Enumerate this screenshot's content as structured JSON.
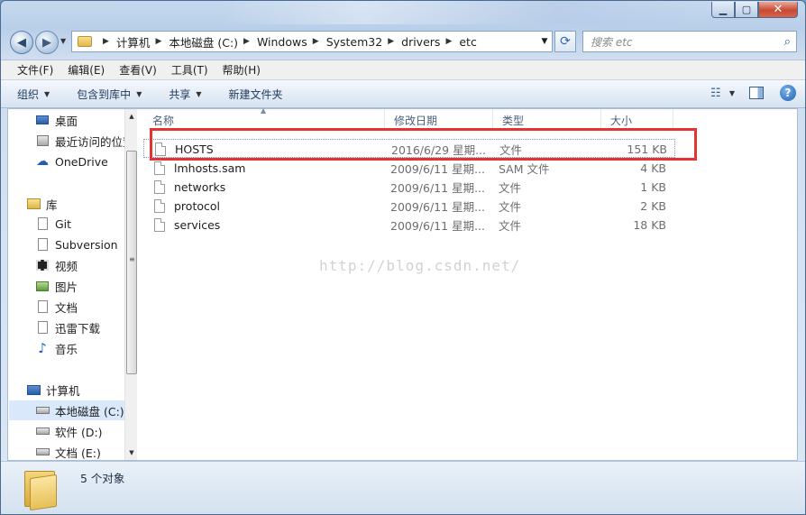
{
  "address": {
    "crumbs": [
      "计算机",
      "本地磁盘 (C:)",
      "Windows",
      "System32",
      "drivers",
      "etc"
    ]
  },
  "search": {
    "placeholder": "搜索 etc"
  },
  "menu": [
    "文件(F)",
    "编辑(E)",
    "查看(V)",
    "工具(T)",
    "帮助(H)"
  ],
  "toolbar": {
    "organize": "组织",
    "include_in_library": "包含到库中",
    "share": "共享",
    "new_folder": "新建文件夹"
  },
  "nav": {
    "desktop": "桌面",
    "recent": "最近访问的位置",
    "onedrive": "OneDrive",
    "libraries": "库",
    "git": "Git",
    "subversion": "Subversion",
    "videos": "视频",
    "pictures": "图片",
    "documents": "文档",
    "xunlei": "迅雷下载",
    "music": "音乐",
    "computer": "计算机",
    "local_c": "本地磁盘 (C:)",
    "soft_d": "软件 (D:)",
    "docs_e": "文档 (E:)"
  },
  "columns": {
    "name": "名称",
    "date": "修改日期",
    "type": "类型",
    "size": "大小"
  },
  "files": [
    {
      "name": "HOSTS",
      "date": "2016/6/29 星期...",
      "type": "文件",
      "size": "151 KB"
    },
    {
      "name": "lmhosts.sam",
      "date": "2009/6/11 星期...",
      "type": "SAM 文件",
      "size": "4 KB"
    },
    {
      "name": "networks",
      "date": "2009/6/11 星期...",
      "type": "文件",
      "size": "1 KB"
    },
    {
      "name": "protocol",
      "date": "2009/6/11 星期...",
      "type": "文件",
      "size": "2 KB"
    },
    {
      "name": "services",
      "date": "2009/6/11 星期...",
      "type": "文件",
      "size": "18 KB"
    }
  ],
  "watermark": "http://blog.csdn.net/",
  "status": {
    "count": "5 个对象"
  },
  "colors": {
    "highlight": "#e53333",
    "selection": "#d9e8fb"
  }
}
